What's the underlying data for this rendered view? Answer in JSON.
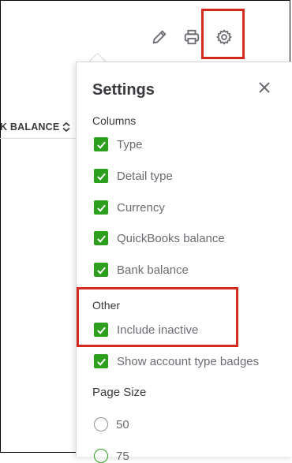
{
  "toolbar": {
    "edit_icon": "pencil-icon",
    "print_icon": "printer-icon",
    "settings_icon": "gear-icon"
  },
  "table": {
    "column_header": "K BALANCE"
  },
  "settings": {
    "title": "Settings",
    "columns_label": "Columns",
    "columns": [
      {
        "label": "Type",
        "checked": true
      },
      {
        "label": "Detail type",
        "checked": true
      },
      {
        "label": "Currency",
        "checked": true
      },
      {
        "label": "QuickBooks balance",
        "checked": true
      },
      {
        "label": "Bank balance",
        "checked": true
      }
    ],
    "other_label": "Other",
    "other": [
      {
        "label": "Include inactive",
        "checked": true
      },
      {
        "label": "Show account type badges",
        "checked": true
      }
    ],
    "page_size_label": "Page Size",
    "page_sizes": [
      {
        "label": "50",
        "selected": false
      },
      {
        "label": "75",
        "selected": true
      }
    ]
  },
  "colors": {
    "accent_green": "#2ca01c",
    "highlight_red": "#d52b1e"
  }
}
